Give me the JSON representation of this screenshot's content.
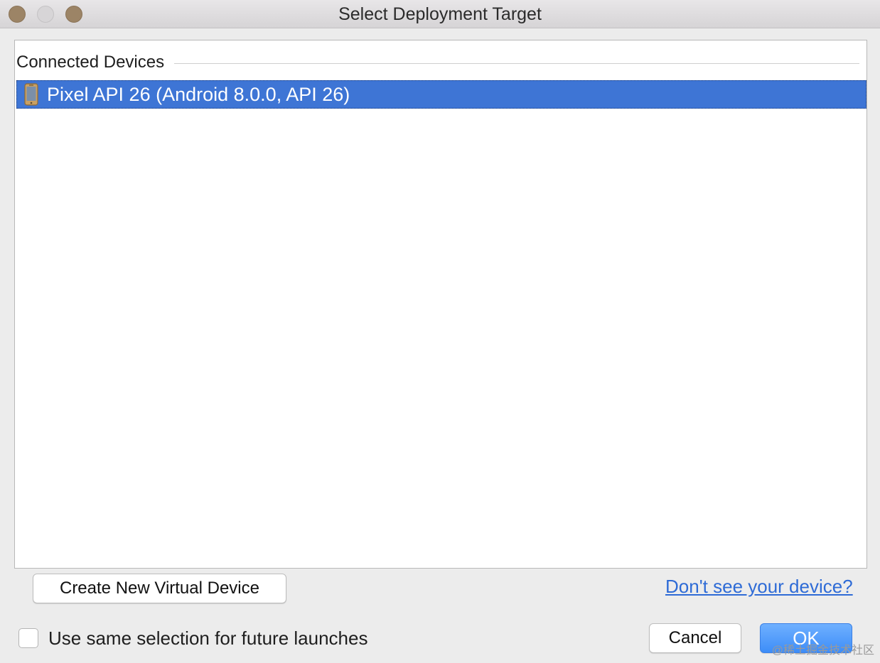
{
  "window": {
    "title": "Select Deployment Target"
  },
  "devices": {
    "section_label": "Connected Devices",
    "items": [
      {
        "label": "Pixel API 26 (Android 8.0.0, API 26)",
        "icon": "phone-icon",
        "selected": true
      }
    ]
  },
  "actions": {
    "create_label": "Create New Virtual Device",
    "help_link": "Don't see your device?",
    "checkbox_label": "Use same selection for future launches",
    "checkbox_checked": false,
    "cancel_label": "Cancel",
    "ok_label": "OK"
  },
  "watermark": "@稀土掘金技术社区",
  "colors": {
    "selection": "#3e75d5",
    "link": "#2e6bd6",
    "ok_button": "#3d8df8",
    "close_button": "#9c8466"
  }
}
